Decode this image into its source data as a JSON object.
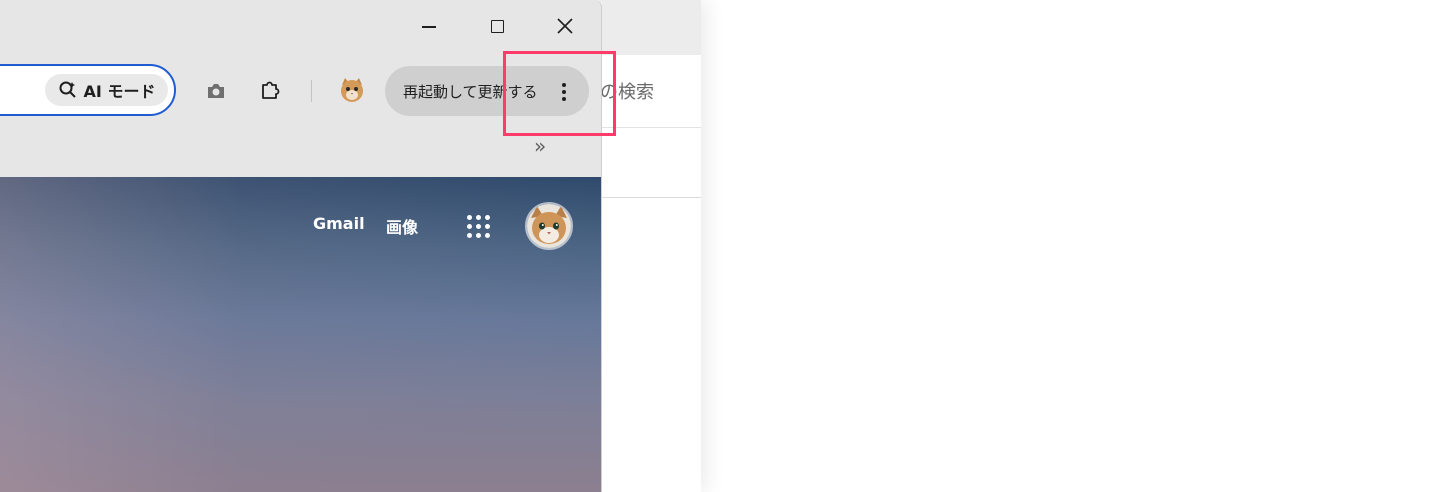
{
  "window": {
    "minimize_icon": "minimize-icon",
    "maximize_icon": "maximize-icon",
    "close_icon": "close-icon"
  },
  "toolbar": {
    "ai_mode_label": "AI モード",
    "camera_icon": "camera-icon",
    "extensions_icon": "puzzle-icon",
    "profile_icon": "cat-avatar-icon",
    "update_button_label": "再起動して更新する",
    "menu_icon": "kebab-menu-icon",
    "overflow_label": "»",
    "accent_color": "#1f5bd1",
    "highlight_color": "#ff3b6b"
  },
  "page": {
    "gmail_label": "Gmail",
    "images_label": "画像",
    "apps_icon": "apps-grid-icon",
    "avatar_icon": "cat-avatar-icon"
  },
  "background_window": {
    "search_text": "の検索"
  }
}
